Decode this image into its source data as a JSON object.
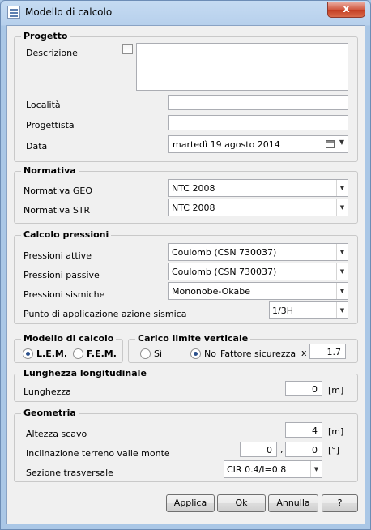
{
  "window": {
    "title": "Modello di calcolo",
    "close_symbol": "x"
  },
  "progetto": {
    "legend": "Progetto",
    "descrizione_label": "Descrizione",
    "descrizione_value": "",
    "localita_label": "Località",
    "localita_value": "",
    "progettista_label": "Progettista",
    "progettista_value": "",
    "data_label": "Data",
    "data_value": "martedì   19   agosto   2014"
  },
  "normativa": {
    "legend": "Normativa",
    "geo_label": "Normativa GEO",
    "geo_value": "NTC 2008",
    "str_label": "Normativa STR",
    "str_value": "NTC 2008"
  },
  "pressioni": {
    "legend": "Calcolo pressioni",
    "attive_label": "Pressioni attive",
    "attive_value": "Coulomb (CSN 730037)",
    "passive_label": "Pressioni passive",
    "passive_value": "Coulomb (CSN 730037)",
    "sismiche_label": "Pressioni sismiche",
    "sismiche_value": "Mononobe-Okabe",
    "punto_label": "Punto di applicazione azione sismica",
    "punto_value": "1/3H"
  },
  "modello": {
    "legend": "Modello di calcolo",
    "lem_label": "L.E.M.",
    "fem_label": "F.E.M.",
    "selected": "L.E.M."
  },
  "carico": {
    "legend": "Carico limite verticale",
    "si_label": "Sì",
    "no_label": "No",
    "selected": "No",
    "fattore_label": "Fattore sicurezza",
    "x_label": "x",
    "fattore_value": "1.7"
  },
  "lunghezza": {
    "legend": "Lunghezza longitudinale",
    "label": "Lunghezza",
    "value": "0",
    "unit": "[m]"
  },
  "geometria": {
    "legend": "Geometria",
    "altezza_label": "Altezza scavo",
    "altezza_value": "4",
    "altezza_unit": "[m]",
    "inclinazione_label": "Inclinazione terreno valle monte",
    "incl_valle": "0",
    "incl_sep": ",",
    "incl_monte": "0",
    "incl_unit": "[°]",
    "sezione_label": "Sezione trasversale",
    "sezione_value": "CIR 0.4/I=0.8"
  },
  "buttons": {
    "applica": "Applica",
    "ok": "Ok",
    "annulla": "Annulla",
    "help": "?"
  }
}
